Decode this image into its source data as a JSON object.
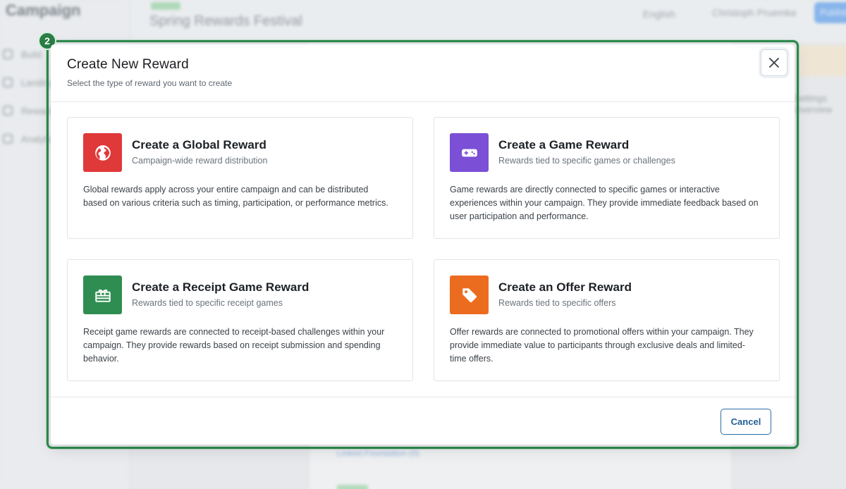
{
  "background": {
    "brand": "Campaign",
    "nav": [
      "Build",
      "Landing",
      "Rewards",
      "Analytics"
    ],
    "campaign_name": "Spring Rewards Festival",
    "language": "English",
    "user": "Christoph Pruemke",
    "primary_button": "Publish",
    "right_panel_lines": [
      "Settings",
      "Overview"
    ],
    "link": "Linked Foundation (0)"
  },
  "modal": {
    "step_number": "2",
    "title": "Create New Reward",
    "subtitle": "Select the type of reward you want to create",
    "close_icon": "close-icon",
    "accent_ring_color": "#2c8c4c",
    "cards": [
      {
        "title": "Create a Global Reward",
        "subtitle": "Campaign-wide reward distribution",
        "description": "Global rewards apply across your entire campaign and can be distributed based on various criteria such as timing, participation, or performance metrics.",
        "icon": "globe-icon",
        "color": "#e0393a"
      },
      {
        "title": "Create a Game Reward",
        "subtitle": "Rewards tied to specific games or challenges",
        "description": "Game rewards are directly connected to specific games or interactive experiences within your campaign. They provide immediate feedback based on user participation and performance.",
        "icon": "gamepad-icon",
        "color": "#7b4fd6"
      },
      {
        "title": "Create a Receipt Game Reward",
        "subtitle": "Rewards tied to specific receipt games",
        "description": "Receipt game rewards are connected to receipt-based challenges within your campaign. They provide rewards based on receipt submission and spending behavior.",
        "icon": "receipt-gift-icon",
        "color": "#2f8d52"
      },
      {
        "title": "Create an Offer Reward",
        "subtitle": "Rewards tied to specific offers",
        "description": "Offer rewards are connected to promotional offers within your campaign. They provide immediate value to participants through exclusive deals and limited-time offers.",
        "icon": "tag-icon",
        "color": "#ec6c1f"
      }
    ],
    "cancel_label": "Cancel"
  }
}
